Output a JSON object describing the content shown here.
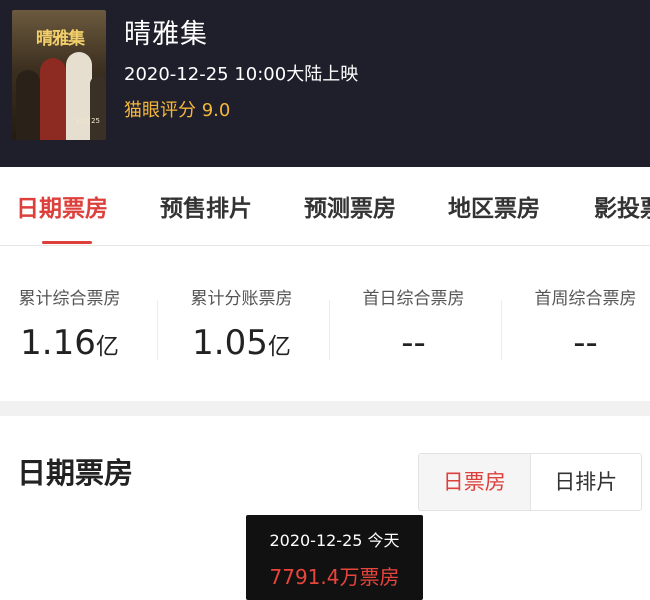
{
  "movie": {
    "title": "晴雅集",
    "release": "2020-12-25 10:00大陆上映",
    "rating": "猫眼评分 9.0",
    "poster": {
      "title_art": "晴雅集",
      "date_text": "12月25"
    }
  },
  "tabs": [
    {
      "label": "日期票房",
      "active": true
    },
    {
      "label": "预售排片",
      "active": false
    },
    {
      "label": "预测票房",
      "active": false
    },
    {
      "label": "地区票房",
      "active": false
    },
    {
      "label": "影投票",
      "active": false
    }
  ],
  "stats": [
    {
      "label": "累计综合票房",
      "value": "1.16",
      "unit": "亿"
    },
    {
      "label": "累计分账票房",
      "value": "1.05",
      "unit": "亿"
    },
    {
      "label": "首日综合票房",
      "value": "--",
      "unit": ""
    },
    {
      "label": "首周综合票房",
      "value": "--",
      "unit": ""
    }
  ],
  "section": {
    "title": "日期票房",
    "toggle": [
      {
        "label": "日票房",
        "active": true
      },
      {
        "label": "日排片",
        "active": false
      }
    ]
  },
  "tooltip": {
    "date": "2020-12-25 今天",
    "value": "7791.4万票房"
  },
  "colors": {
    "accent": "#dd403b",
    "rating": "#f5b73a",
    "header_bg": "#1f1e2b"
  }
}
